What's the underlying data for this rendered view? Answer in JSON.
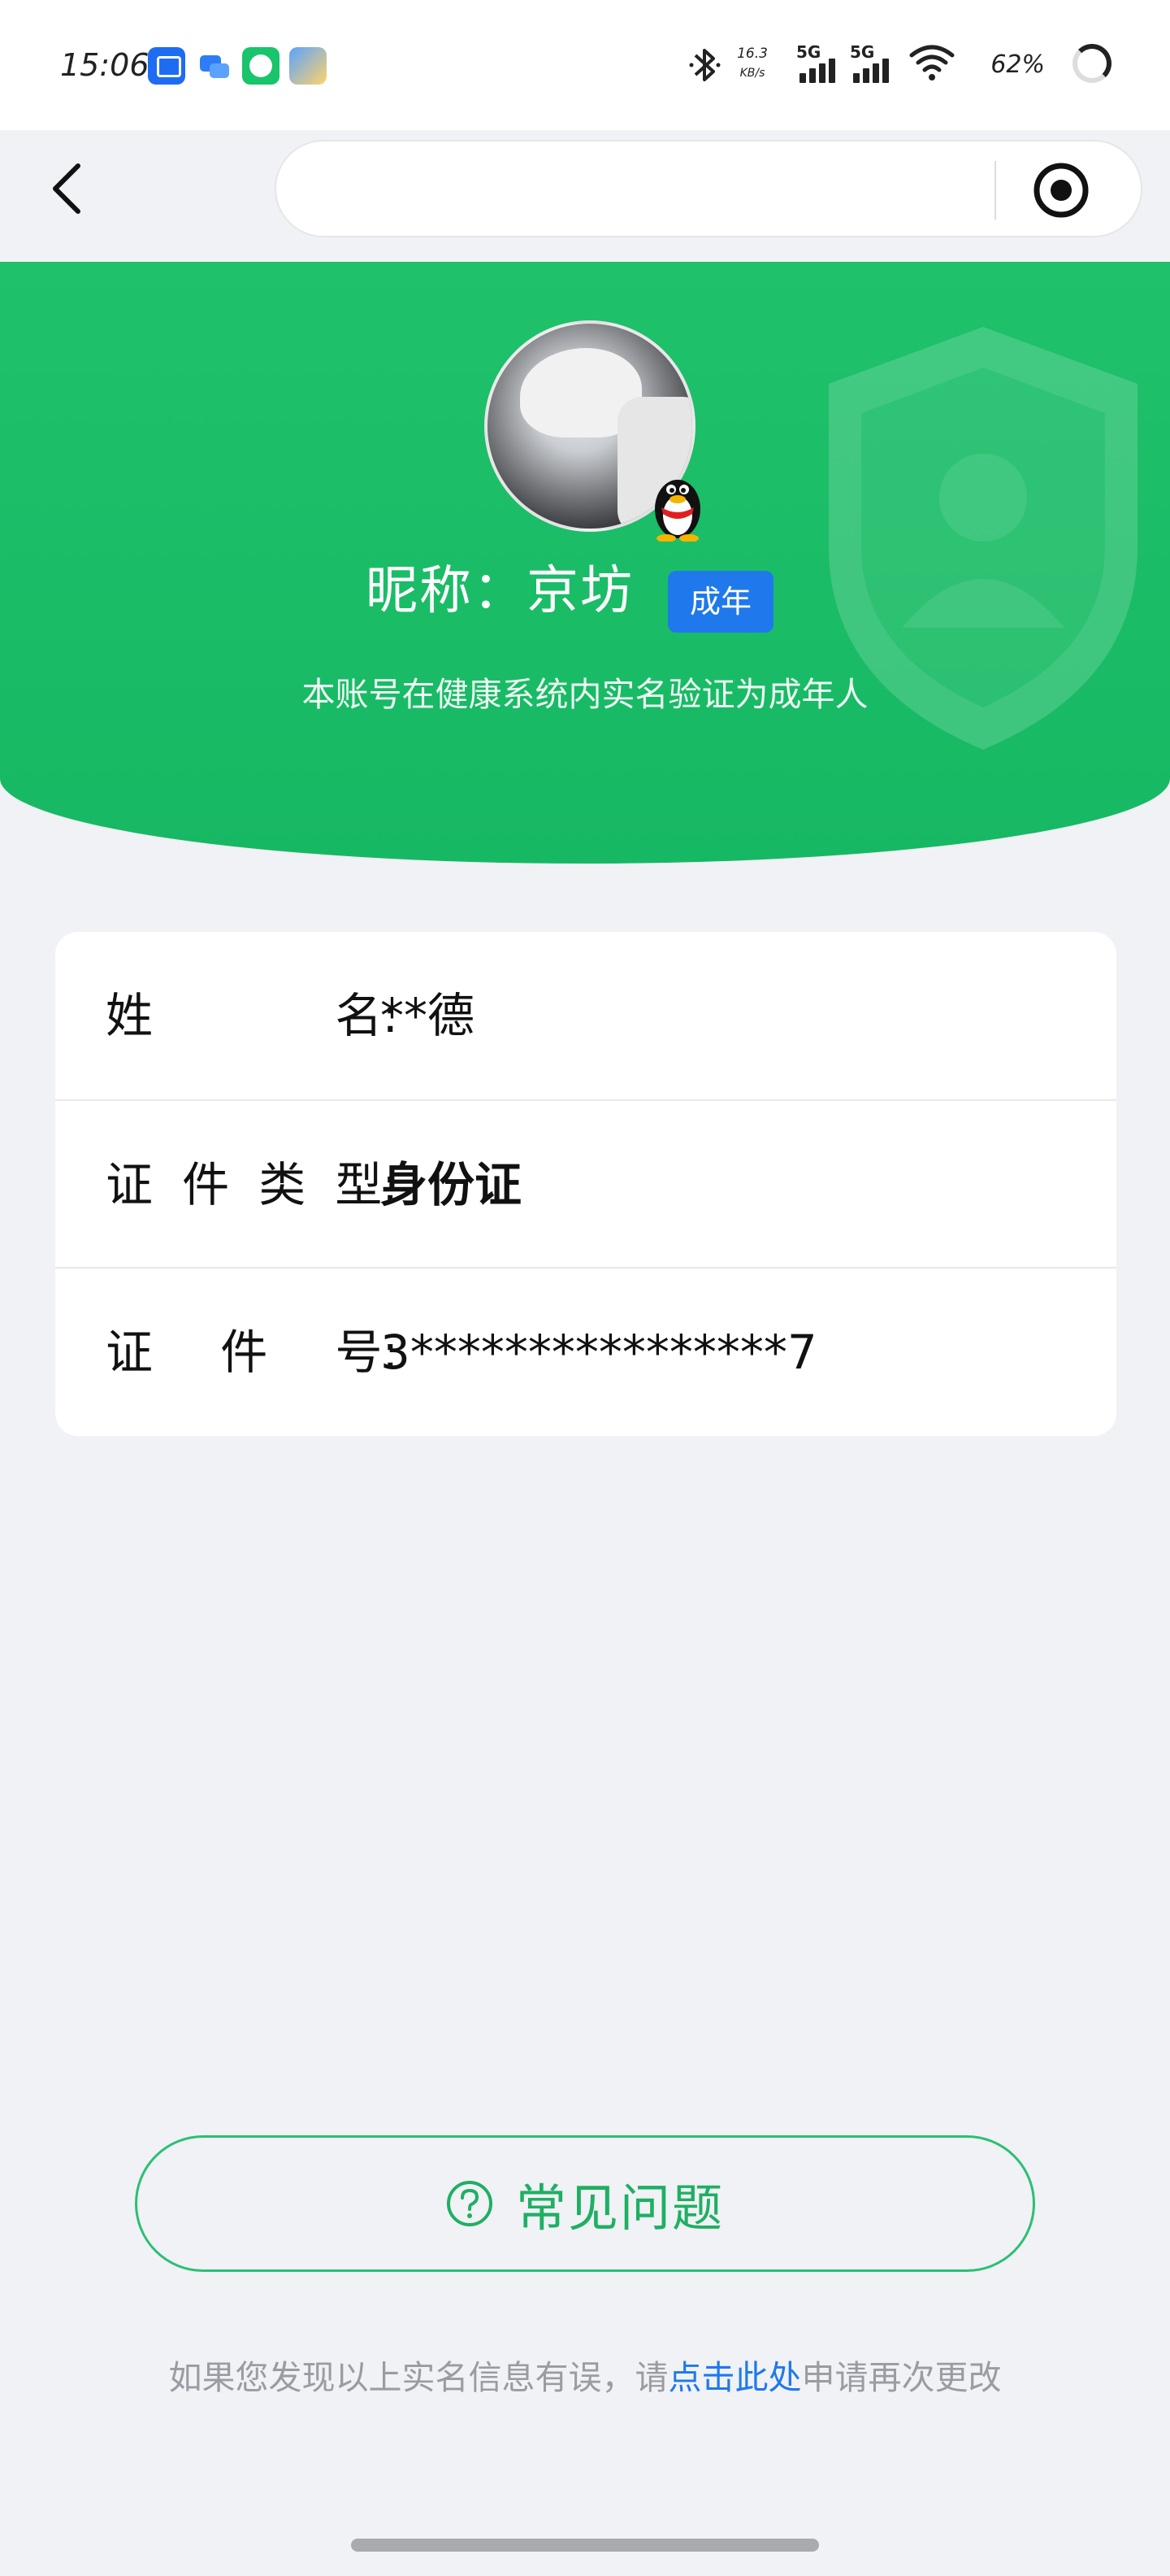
{
  "status_bar": {
    "time": "15:06",
    "net_speed_value": "16.3",
    "net_speed_unit": "KB/s",
    "sim1": "5G",
    "sim2": "5G",
    "battery": "62%"
  },
  "nav": {
    "search_placeholder": "",
    "back_icon": "chevron-left-icon",
    "action_icon": "target-icon"
  },
  "profile": {
    "nickname_label": "昵称：",
    "nickname": "京坊",
    "age_badge": "成年",
    "description": "本账号在健康系统内实名验证为成年人",
    "accent_color": "#1fc16b",
    "badge_color": "#1f79ec"
  },
  "info": {
    "name_label_chars": [
      "姓",
      "名:"
    ],
    "name_value": "**德",
    "id_type_label_chars": [
      "证",
      "件",
      "类",
      "型:"
    ],
    "id_type_value": "身份证",
    "id_number_label_chars": [
      "证",
      "件",
      "号:"
    ],
    "id_number_value": "3****************7"
  },
  "faq": {
    "label": "常见问题",
    "icon": "question-circle-icon"
  },
  "footer": {
    "text_before": "如果您发现以上实名信息有误，请",
    "link": "点击此处",
    "text_after": "申请再次更改",
    "link_color": "#1f79ec"
  }
}
